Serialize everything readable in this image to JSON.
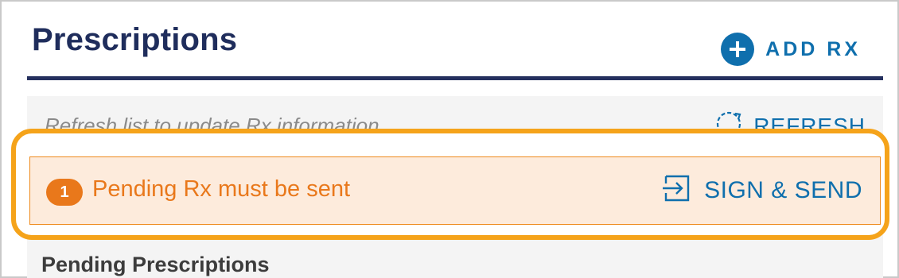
{
  "header": {
    "title": "Prescriptions",
    "add_button_label": "ADD RX"
  },
  "refresh_row": {
    "message": "Refresh list to update Rx information.",
    "refresh_label": "REFRESH"
  },
  "alert": {
    "count": "1",
    "message": "Pending Rx must be sent",
    "action_label": "SIGN & SEND"
  },
  "section": {
    "title": "Pending Prescriptions"
  },
  "colors": {
    "title": "#1f2d5c",
    "accent_blue": "#0f6fad",
    "alert_orange": "#e9781b",
    "alert_bg": "#fdebdc",
    "highlight": "#f5a31a"
  },
  "icons": {
    "add": "plus-circle-icon",
    "refresh": "refresh-icon",
    "sign_send": "sign-in-arrow-icon"
  }
}
